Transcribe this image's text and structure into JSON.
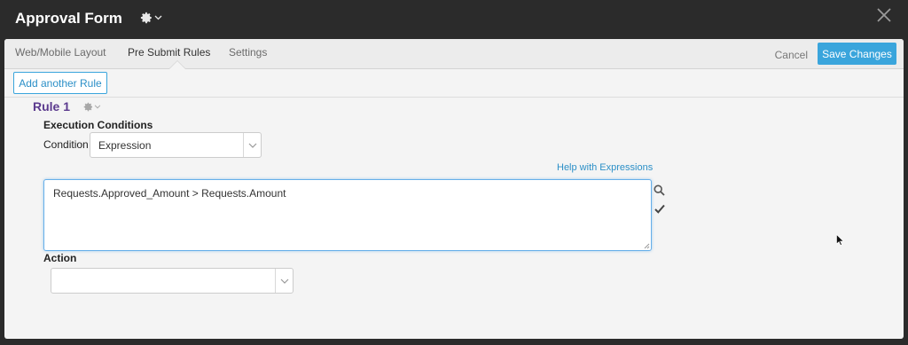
{
  "window": {
    "title": "Approval Form",
    "gear_icon": "gear-icon",
    "close_icon": "close-icon"
  },
  "tabs": [
    {
      "label": "Web/Mobile Layout",
      "active": false
    },
    {
      "label": "Pre Submit Rules",
      "active": true
    },
    {
      "label": "Settings",
      "active": false
    }
  ],
  "actions": {
    "cancel_label": "Cancel",
    "save_label": "Save Changes"
  },
  "toolbar": {
    "add_rule_label": "Add another Rule"
  },
  "rule": {
    "title": "Rule 1",
    "execution_conditions_label": "Execution Conditions",
    "condition_label": "Condition",
    "condition_value": "Expression",
    "help_link": "Help with Expressions",
    "expression": "Requests.Approved_Amount > Requests.Amount",
    "action_label": "Action",
    "action_value": ""
  },
  "colors": {
    "accent": "#3aa5dc",
    "rule_title": "#5b3a8e",
    "link": "#2b8fc7",
    "titlebar_bg": "#2b2b2b"
  }
}
